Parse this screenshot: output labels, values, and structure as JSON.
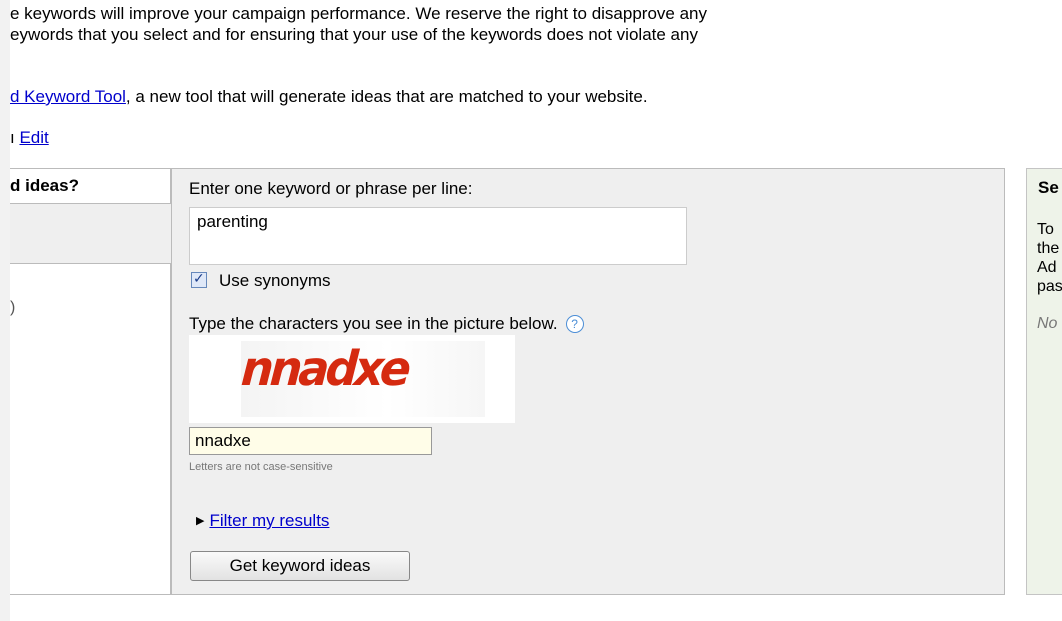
{
  "intro": {
    "line1": "e keywords will improve your campaign performance. We reserve the right to disapprove any",
    "line2": "eywords that you select and for ensuring that your use of the keywords does not violate any",
    "line3_link": "d Keyword Tool",
    "line3_rest": ", a new tool that will generate ideas that are matched to your website.",
    "line4_prefix": "ı ",
    "line4_link": "Edit"
  },
  "left_panel": {
    "title": "d ideas?",
    "paren": ")"
  },
  "form": {
    "keyword_label": "Enter one keyword or phrase per line:",
    "keyword_value": "parenting",
    "synonyms_label": "Use synonyms",
    "synonyms_checked": true,
    "captcha_label": "Type the characters you see in the picture below.",
    "help_icon": "question-mark-icon",
    "captcha_image_text": "nnadxe",
    "captcha_value": "nnadxe",
    "hint": "Letters are not case-sensitive",
    "filter_link": "Filter my results",
    "submit_label": "Get keyword ideas"
  },
  "right_panel": {
    "title": "Se",
    "body_lines": [
      "To",
      "the",
      "Ad",
      "pas"
    ],
    "note": "No"
  },
  "colors": {
    "link": "#0000cc",
    "panel_bg": "#efefef",
    "right_panel_bg": "#eef3e9",
    "captcha_input_bg": "#fffde8",
    "captcha_red": "#d52a10"
  }
}
